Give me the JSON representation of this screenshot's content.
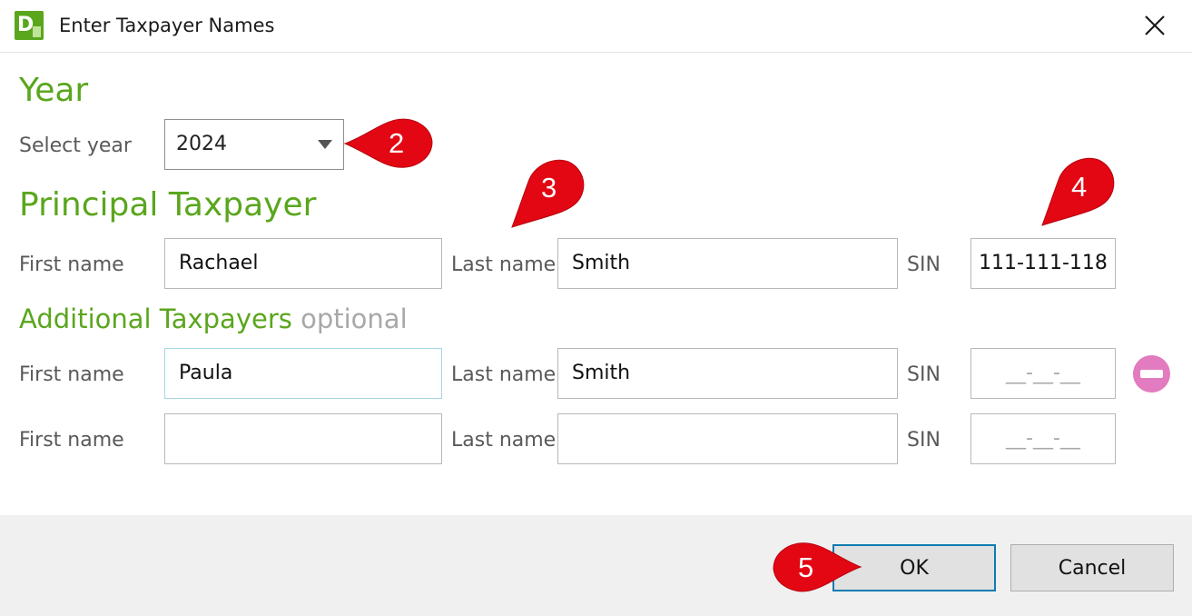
{
  "window": {
    "title": "Enter Taxpayer Names",
    "app_icon": "dr-tax-app-icon",
    "close_icon": "close-icon"
  },
  "year_section": {
    "heading": "Year",
    "select_label": "Select year",
    "selected_year": "2024"
  },
  "principal_section": {
    "heading": "Principal Taxpayer",
    "first_name_label": "First name",
    "first_name_value": "Rachael",
    "last_name_label": "Last name",
    "last_name_value": "Smith",
    "sin_label": "SIN",
    "sin_value": "111-111-118"
  },
  "additional_section": {
    "heading": "Additional Taxpayers",
    "heading_note": "optional",
    "rows": [
      {
        "first_name_label": "First name",
        "first_name_value": "Paula",
        "last_name_label": "Last name",
        "last_name_value": "Smith",
        "sin_label": "SIN",
        "sin_value": "__-__-__"
      },
      {
        "first_name_label": "First name",
        "first_name_value": "",
        "last_name_label": "Last name",
        "last_name_value": "",
        "sin_label": "SIN",
        "sin_value": "__-__-__"
      }
    ],
    "remove_icon": "remove-circle-icon"
  },
  "footer": {
    "ok_label": "OK",
    "cancel_label": "Cancel"
  },
  "callouts": {
    "marker_2": "2",
    "marker_3": "3",
    "marker_4": "4",
    "marker_5": "5",
    "color": "#e30613"
  },
  "colors": {
    "accent_green": "#5aa61d",
    "optional_gray": "#a8a8a8",
    "ok_border": "#0f7bb0",
    "remove_pink": "#e27bbf"
  }
}
